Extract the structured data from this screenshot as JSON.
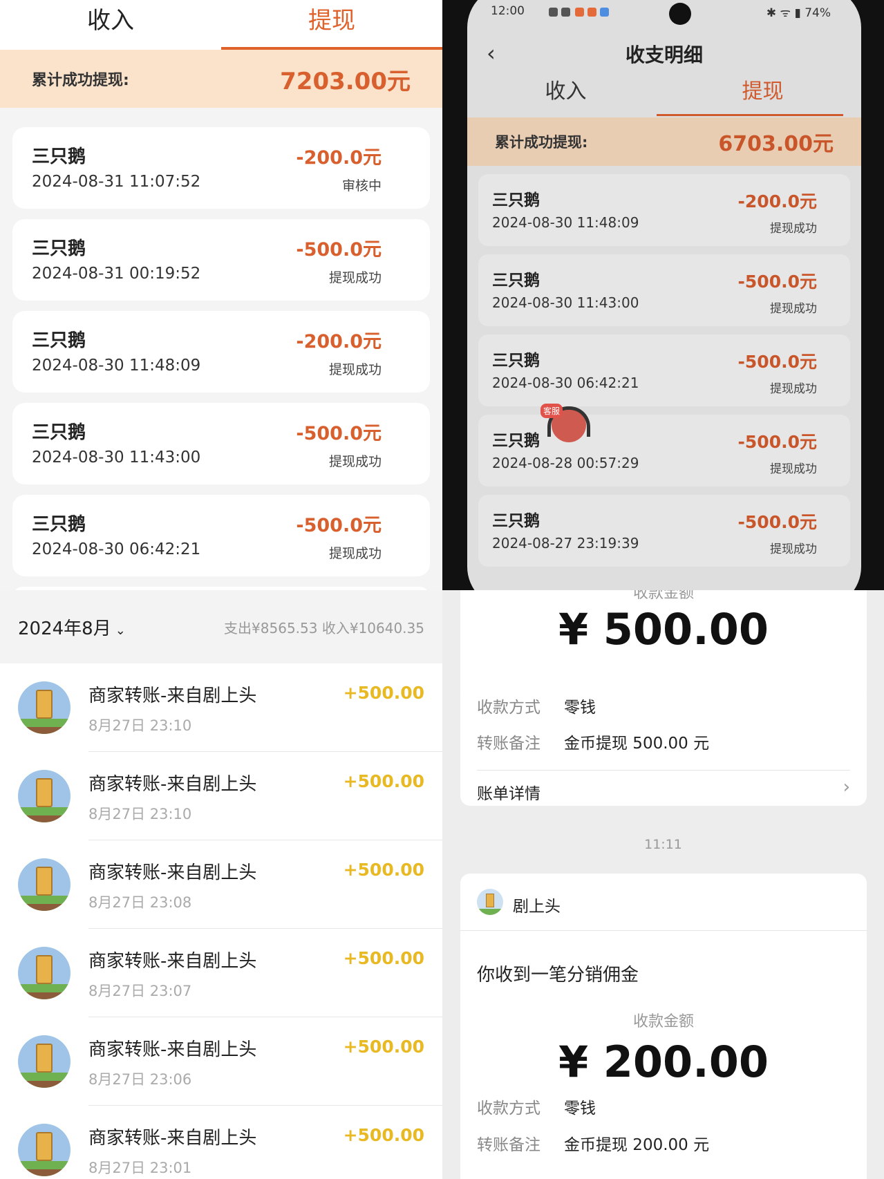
{
  "tl": {
    "tabs": [
      "收入",
      "提现"
    ],
    "summary_label": "累计成功提现:",
    "summary_value": "7203.00元",
    "rows": [
      {
        "name": "三只鹅",
        "time": "2024-08-31 11:07:52",
        "amount": "-200.0元",
        "status": "审核中"
      },
      {
        "name": "三只鹅",
        "time": "2024-08-31 00:19:52",
        "amount": "-500.0元",
        "status": "提现成功"
      },
      {
        "name": "三只鹅",
        "time": "2024-08-30 11:48:09",
        "amount": "-200.0元",
        "status": "提现成功"
      },
      {
        "name": "三只鹅",
        "time": "2024-08-30 11:43:00",
        "amount": "-500.0元",
        "status": "提现成功"
      },
      {
        "name": "三只鹅",
        "time": "2024-08-30 06:42:21",
        "amount": "-500.0元",
        "status": "提现成功"
      }
    ]
  },
  "tr": {
    "status_time": "12:00",
    "status_right": "✱ ᯤ ▮ 74%",
    "title": "收支明细",
    "back": "‹",
    "tabs": [
      "收入",
      "提现"
    ],
    "summary_label": "累计成功提现:",
    "summary_value": "6703.00元",
    "kefu_label": "客服",
    "rows": [
      {
        "name": "三只鹅",
        "time": "2024-08-30 11:48:09",
        "amount": "-200.0元",
        "status": "提现成功"
      },
      {
        "name": "三只鹅",
        "time": "2024-08-30 11:43:00",
        "amount": "-500.0元",
        "status": "提现成功"
      },
      {
        "name": "三只鹅",
        "time": "2024-08-30 06:42:21",
        "amount": "-500.0元",
        "status": "提现成功"
      },
      {
        "name": "三只鹅",
        "time": "2024-08-28 00:57:29",
        "amount": "-500.0元",
        "status": "提现成功"
      },
      {
        "name": "三只鹅",
        "time": "2024-08-27 23:19:39",
        "amount": "-500.0元",
        "status": "提现成功"
      }
    ]
  },
  "bl": {
    "month": "2024年8月",
    "totals": "支出¥8565.53  收入¥10640.35",
    "rows": [
      {
        "title": "商家转账-来自剧上头",
        "time": "8月27日 23:10",
        "amount": "+500.00"
      },
      {
        "title": "商家转账-来自剧上头",
        "time": "8月27日 23:10",
        "amount": "+500.00"
      },
      {
        "title": "商家转账-来自剧上头",
        "time": "8月27日 23:08",
        "amount": "+500.00"
      },
      {
        "title": "商家转账-来自剧上头",
        "time": "8月27日 23:07",
        "amount": "+500.00"
      },
      {
        "title": "商家转账-来自剧上头",
        "time": "8月27日 23:06",
        "amount": "+500.00"
      },
      {
        "title": "商家转账-来自剧上头",
        "time": "8月27日 23:01",
        "amount": "+500.00"
      }
    ]
  },
  "br": {
    "card1": {
      "caption": "收款金额",
      "amount": "¥ 500.00",
      "method_label": "收款方式",
      "method": "零钱",
      "note_label": "转账备注",
      "note": "金币提现 500.00 元",
      "detail": "账单详情",
      "arrow": "›"
    },
    "timestamp": "11:11",
    "card2": {
      "sender": "剧上头",
      "message": "你收到一笔分销佣金",
      "caption": "收款金额",
      "amount": "¥ 200.00",
      "method_label": "收款方式",
      "method": "零钱",
      "note_label": "转账备注",
      "note": "金币提现 200.00 元"
    }
  },
  "colors": {
    "accent": "#e0622b",
    "income": "#e8b923"
  }
}
